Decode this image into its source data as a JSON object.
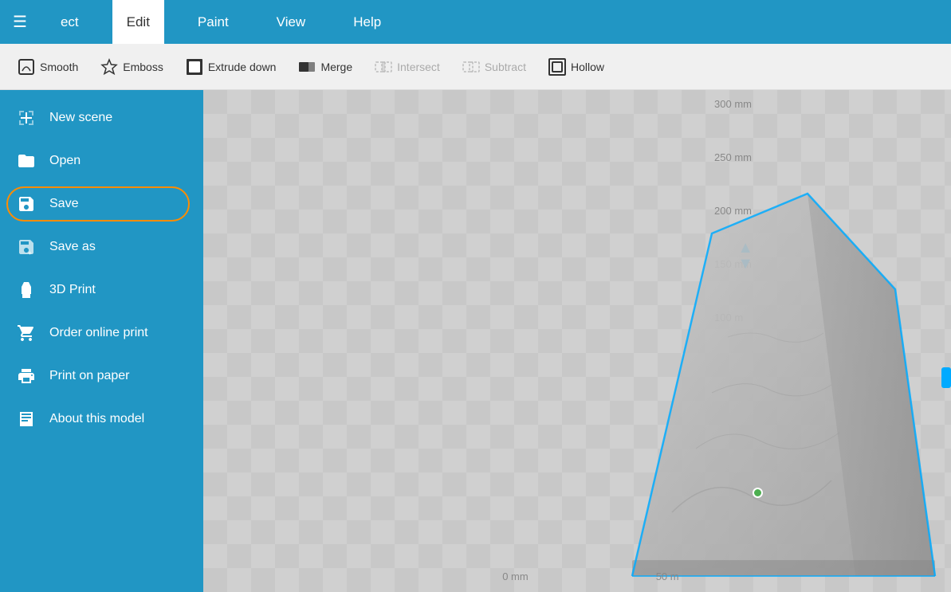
{
  "titleBar": {
    "hamburger": "☰",
    "tabPartial": "ect",
    "tabs": [
      {
        "id": "edit",
        "label": "Edit",
        "active": true
      },
      {
        "id": "paint",
        "label": "Paint",
        "active": false
      },
      {
        "id": "view",
        "label": "View",
        "active": false
      },
      {
        "id": "help",
        "label": "Help",
        "active": false
      }
    ]
  },
  "toolbar": {
    "items": [
      {
        "id": "smooth",
        "label": "Smooth",
        "icon": "smooth",
        "disabled": false
      },
      {
        "id": "emboss",
        "label": "Emboss",
        "icon": "star",
        "disabled": false
      },
      {
        "id": "extrude-down",
        "label": "Extrude down",
        "icon": "extrude",
        "disabled": false
      },
      {
        "id": "merge",
        "label": "Merge",
        "icon": "merge",
        "disabled": false
      },
      {
        "id": "intersect",
        "label": "Intersect",
        "icon": "intersect",
        "disabled": true
      },
      {
        "id": "subtract",
        "label": "Subtract",
        "icon": "subtract",
        "disabled": true
      },
      {
        "id": "hollow",
        "label": "Hollow",
        "icon": "hollow",
        "disabled": false
      }
    ]
  },
  "sidebar": {
    "items": [
      {
        "id": "new-scene",
        "label": "New scene",
        "icon": "new-scene"
      },
      {
        "id": "open",
        "label": "Open",
        "icon": "open"
      },
      {
        "id": "save",
        "label": "Save",
        "icon": "save",
        "highlighted": true
      },
      {
        "id": "save-as",
        "label": "Save as",
        "icon": "save-as"
      },
      {
        "id": "3d-print",
        "label": "3D Print",
        "icon": "3d-print"
      },
      {
        "id": "order-online",
        "label": "Order online print",
        "icon": "order-online"
      },
      {
        "id": "print-paper",
        "label": "Print on paper",
        "icon": "print-paper"
      },
      {
        "id": "about-model",
        "label": "About this model",
        "icon": "about-model"
      }
    ]
  },
  "canvas": {
    "rulerLabels": [
      "300 mm",
      "250 mm",
      "200 mm",
      "150 mm",
      "100 m"
    ],
    "bottomLabels": [
      "0 mm",
      "50 m"
    ]
  }
}
